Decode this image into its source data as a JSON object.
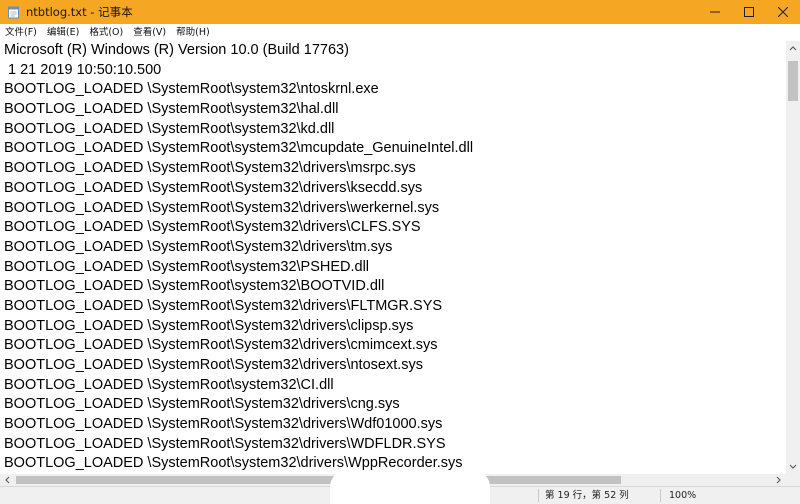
{
  "window": {
    "title": "ntbtlog.txt - 记事本"
  },
  "menu": [
    "文件(F)",
    "编辑(E)",
    "格式(O)",
    "查看(V)",
    "帮助(H)"
  ],
  "editor": {
    "lines": [
      "Microsoft (R) Windows (R) Version 10.0 (Build 17763)",
      " 1 21 2019 10:50:10.500",
      "BOOTLOG_LOADED \\SystemRoot\\system32\\ntoskrnl.exe",
      "BOOTLOG_LOADED \\SystemRoot\\system32\\hal.dll",
      "BOOTLOG_LOADED \\SystemRoot\\system32\\kd.dll",
      "BOOTLOG_LOADED \\SystemRoot\\system32\\mcupdate_GenuineIntel.dll",
      "BOOTLOG_LOADED \\SystemRoot\\System32\\drivers\\msrpc.sys",
      "BOOTLOG_LOADED \\SystemRoot\\System32\\drivers\\ksecdd.sys",
      "BOOTLOG_LOADED \\SystemRoot\\System32\\drivers\\werkernel.sys",
      "BOOTLOG_LOADED \\SystemRoot\\System32\\drivers\\CLFS.SYS",
      "BOOTLOG_LOADED \\SystemRoot\\System32\\drivers\\tm.sys",
      "BOOTLOG_LOADED \\SystemRoot\\system32\\PSHED.dll",
      "BOOTLOG_LOADED \\SystemRoot\\system32\\BOOTVID.dll",
      "BOOTLOG_LOADED \\SystemRoot\\System32\\drivers\\FLTMGR.SYS",
      "BOOTLOG_LOADED \\SystemRoot\\System32\\drivers\\clipsp.sys",
      "BOOTLOG_LOADED \\SystemRoot\\System32\\drivers\\cmimcext.sys",
      "BOOTLOG_LOADED \\SystemRoot\\System32\\drivers\\ntosext.sys",
      "BOOTLOG_LOADED \\SystemRoot\\system32\\CI.dll",
      "BOOTLOG_LOADED \\SystemRoot\\System32\\drivers\\cng.sys",
      "BOOTLOG_LOADED \\SystemRoot\\System32\\drivers\\Wdf01000.sys",
      "BOOTLOG_LOADED \\SystemRoot\\System32\\drivers\\WDFLDR.SYS",
      "BOOTLOG_LOADED \\SystemRoot\\system32\\drivers\\WppRecorder.sys"
    ]
  },
  "status": {
    "position": "第 19 行，第 52 列",
    "zoom": "100%"
  },
  "colors": {
    "titlebar": "#f5a623",
    "background": "#ffffff"
  },
  "icons": {
    "app": "notepad-icon",
    "minimize": "minimize-icon",
    "maximize": "maximize-icon",
    "close": "close-icon"
  }
}
